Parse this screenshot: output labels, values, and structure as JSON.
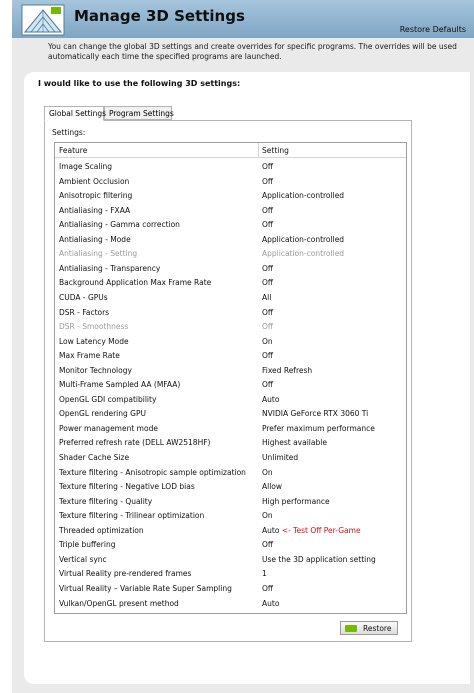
{
  "header": {
    "title": "Manage 3D Settings",
    "restore_defaults": "Restore Defaults",
    "logo_icon": "nvidia-3d-settings-icon"
  },
  "description": "You can change the global 3D settings and create overrides for specific programs. The overrides will be used automatically each time the specified programs are launched.",
  "section_title": "I would like to use the following 3D settings:",
  "tabs": [
    {
      "label": "Global Settings",
      "active": true
    },
    {
      "label": "Program Settings",
      "active": false
    }
  ],
  "settings_label": "Settings:",
  "table": {
    "headers": {
      "feature": "Feature",
      "setting": "Setting"
    },
    "rows": [
      {
        "feature": "Image Scaling",
        "setting": "Off"
      },
      {
        "feature": "Ambient Occlusion",
        "setting": "Off"
      },
      {
        "feature": "Anisotropic filtering",
        "setting": "Application-controlled"
      },
      {
        "feature": "Antialiasing - FXAA",
        "setting": "Off"
      },
      {
        "feature": "Antialiasing - Gamma correction",
        "setting": "Off"
      },
      {
        "feature": "Antialiasing - Mode",
        "setting": "Application-controlled"
      },
      {
        "feature": "Antialiasing - Setting",
        "setting": "Application-controlled",
        "disabled": true
      },
      {
        "feature": "Antialiasing - Transparency",
        "setting": "Off"
      },
      {
        "feature": "Background Application Max Frame Rate",
        "setting": "Off"
      },
      {
        "feature": "CUDA - GPUs",
        "setting": "All"
      },
      {
        "feature": "DSR - Factors",
        "setting": "Off"
      },
      {
        "feature": "DSR - Smoothness",
        "setting": "Off",
        "disabled": true
      },
      {
        "feature": "Low Latency Mode",
        "setting": "On"
      },
      {
        "feature": "Max Frame Rate",
        "setting": "Off"
      },
      {
        "feature": "Monitor Technology",
        "setting": "Fixed Refresh"
      },
      {
        "feature": "Multi-Frame Sampled AA (MFAA)",
        "setting": "Off"
      },
      {
        "feature": "OpenGL GDI compatibility",
        "setting": "Auto"
      },
      {
        "feature": "OpenGL rendering GPU",
        "setting": "NVIDIA GeForce RTX 3060 Ti"
      },
      {
        "feature": "Power management mode",
        "setting": "Prefer maximum performance"
      },
      {
        "feature": "Preferred refresh rate (DELL AW2518HF)",
        "setting": "Highest available"
      },
      {
        "feature": "Shader Cache Size",
        "setting": "Unlimited"
      },
      {
        "feature": "Texture filtering - Anisotropic sample optimization",
        "setting": "On"
      },
      {
        "feature": "Texture filtering - Negative LOD bias",
        "setting": "Allow"
      },
      {
        "feature": "Texture filtering - Quality",
        "setting": "High performance"
      },
      {
        "feature": "Texture filtering - Trilinear optimization",
        "setting": "On"
      },
      {
        "feature": "Threaded optimization",
        "setting": "Auto",
        "note": "<- Test Off Per-Game"
      },
      {
        "feature": "Triple buffering",
        "setting": "Off"
      },
      {
        "feature": "Vertical sync",
        "setting": "Use the 3D application setting"
      },
      {
        "feature": "Virtual Reality pre-rendered frames",
        "setting": "1"
      },
      {
        "feature": "Virtual Reality – Variable Rate Super Sampling",
        "setting": "Off"
      },
      {
        "feature": "Vulkan/OpenGL present method",
        "setting": "Auto"
      }
    ]
  },
  "restore_button": {
    "label": "Restore",
    "icon": "nvidia-logo-icon"
  },
  "colors": {
    "header_top": "#a6c5dc",
    "header_bottom": "#7fa6c4",
    "note_red": "#d01414",
    "nvidia_green": "#76b900",
    "disabled_text": "#9a9a9a"
  }
}
